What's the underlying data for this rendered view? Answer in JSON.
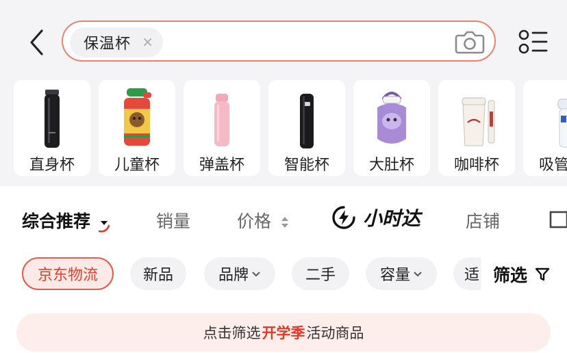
{
  "search": {
    "query": "保温杯",
    "clear_symbol": "×"
  },
  "categories": [
    {
      "label": "直身杯",
      "icon": "slim-black-thermos-icon"
    },
    {
      "label": "儿童杯",
      "icon": "kids-cup-icon"
    },
    {
      "label": "弹盖杯",
      "icon": "pink-flip-lid-bottle-icon"
    },
    {
      "label": "智能杯",
      "icon": "smart-black-bottle-icon"
    },
    {
      "label": "大肚杯",
      "icon": "purple-big-belly-jug-icon"
    },
    {
      "label": "咖啡杯",
      "icon": "coffee-cup-icon"
    },
    {
      "label": "吸管杯",
      "icon": "straw-cup-icon"
    }
  ],
  "sort": {
    "composite": "综合推荐",
    "sales": "销量",
    "price": "价格",
    "express": "小时达",
    "store": "店铺"
  },
  "filters": {
    "chips": [
      {
        "label": "京东物流",
        "selected": true
      },
      {
        "label": "新品"
      },
      {
        "label": "品牌",
        "dropdown": true
      },
      {
        "label": "二手"
      },
      {
        "label": "容量",
        "dropdown": true
      },
      {
        "label": "适"
      }
    ],
    "filter_label": "筛选"
  },
  "banner": {
    "prefix": "点击筛选",
    "highlight": "开学季",
    "suffix": "活动商品"
  },
  "colors": {
    "accent": "#e0392a",
    "search_border": "#e8826e"
  }
}
